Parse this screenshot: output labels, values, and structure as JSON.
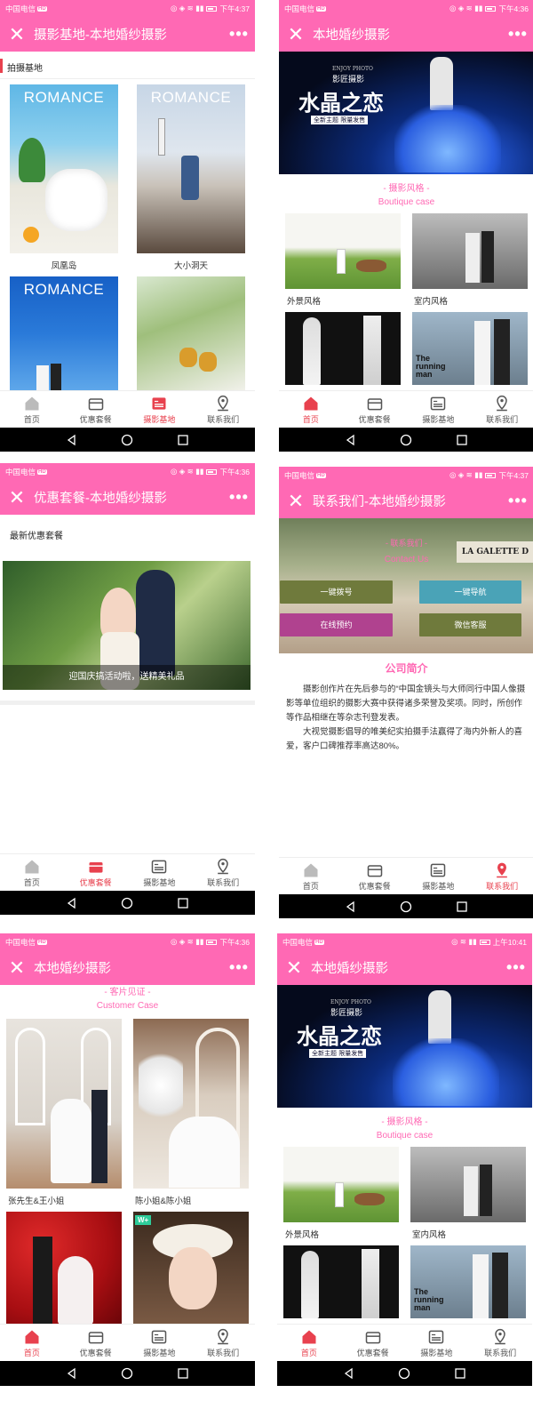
{
  "colors": {
    "brand": "#ff69b4",
    "active": "#e8414e"
  },
  "status": {
    "carrier": "中国电信",
    "hd": "HD",
    "time_a": "下午4:37",
    "time_b": "下午4:36",
    "time_c": "上午10:41"
  },
  "tabs": [
    {
      "label": "首页",
      "icon": "home-icon"
    },
    {
      "label": "优惠套餐",
      "icon": "package-icon"
    },
    {
      "label": "摄影基地",
      "icon": "gallery-icon"
    },
    {
      "label": "联系我们",
      "icon": "location-icon"
    }
  ],
  "screen1": {
    "title": "摄影基地-本地婚纱摄影",
    "section": "拍摄基地",
    "cards": [
      {
        "badge": "ROMANCE",
        "caption": "凤凰岛"
      },
      {
        "badge": "ROMANCE",
        "caption": "大小洞天"
      },
      {
        "badge": "ROMANCE",
        "caption": ""
      },
      {
        "badge": "",
        "caption": ""
      }
    ]
  },
  "home": {
    "title": "本地婚纱摄影",
    "banner_brand": "影匠摄影",
    "banner_brand_en": "ENJOY PHOTO",
    "banner_title": "水晶之恋",
    "banner_sub": "全新主题 限量发售",
    "style_head": "- 摄影风格 -",
    "style_sub": "Boutique case",
    "items": [
      {
        "caption": "外景风格"
      },
      {
        "caption": "室内风格"
      },
      {
        "caption": ""
      },
      {
        "caption": ""
      }
    ]
  },
  "screen3": {
    "title": "优惠套餐-本地婚纱摄影",
    "section": "最新优惠套餐",
    "promo": "迎国庆搞活动啦，送精美礼品"
  },
  "screen4": {
    "title": "联系我们-本地婚纱摄影",
    "contact_head": "- 联系我们 -",
    "contact_sub": "Contact Us",
    "shop_sign": "LA GALETTE D",
    "buttons": [
      "一键拨号",
      "一键导航",
      "在线预约",
      "微信客服"
    ],
    "intro_title": "公司简介",
    "intro_p1": "摄影创作片在先后参与的“中国金镜头与大师同行中国人像摄影等单位组织的摄影大赛中获得诸多荣誉及奖项。同时，所创作等作品相继在等杂志刊登发表。",
    "intro_p2": "大视觉摄影倡导的唯美纪实拍摄手法赢得了海内外新人的喜爱，客户口碑推荐率高达80%。"
  },
  "screen5": {
    "title": "本地婚纱摄影",
    "head": "- 客片见证 -",
    "sub": "Customer Case",
    "cards": [
      {
        "caption": "张先生&王小姐"
      },
      {
        "caption": "陈小姐&陈小姐"
      },
      {
        "caption": ""
      },
      {
        "caption": ""
      }
    ],
    "badge": "W+"
  },
  "sign": {
    "running": "The running man"
  }
}
